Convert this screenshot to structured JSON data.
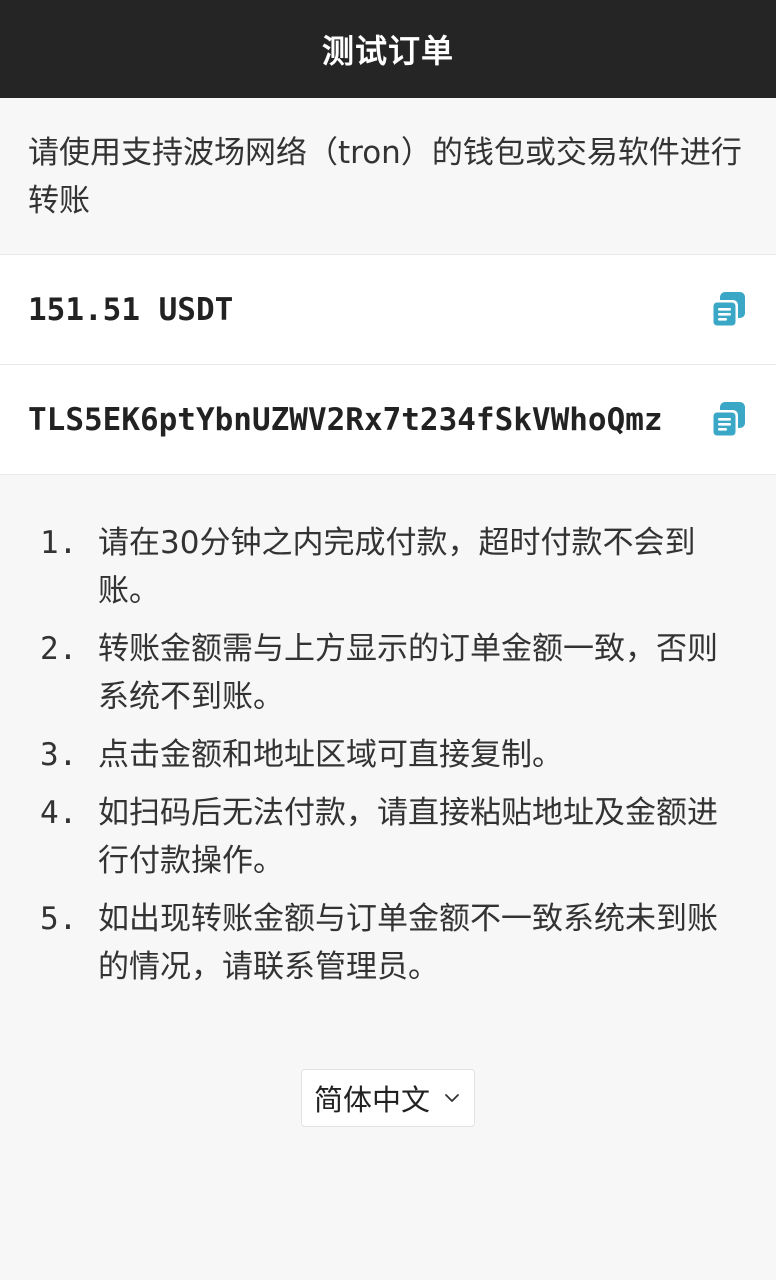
{
  "header": {
    "title": "测试订单"
  },
  "notice": {
    "text": "请使用支持波场网络（tron）的钱包或交易软件进行转账"
  },
  "amount": {
    "value": "151.51 USDT",
    "icon": "copy-icon",
    "icon_color": "#3aa7c6"
  },
  "address": {
    "value": "TLS5EK6ptYbnUZWV2Rx7t234fSkVWhoQmz",
    "icon": "copy-icon",
    "icon_color": "#3aa7c6"
  },
  "instructions": [
    {
      "num": "1.",
      "text": "请在30分钟之内完成付款，超时付款不会到账。"
    },
    {
      "num": "2.",
      "text": "转账金额需与上方显示的订单金额一致，否则系统不到账。"
    },
    {
      "num": "3.",
      "text": "点击金额和地址区域可直接复制。"
    },
    {
      "num": "4.",
      "text": "如扫码后无法付款，请直接粘贴地址及金额进行付款操作。"
    },
    {
      "num": "5.",
      "text": "如出现转账金额与订单金额不一致系统未到账的情况，请联系管理员。"
    }
  ],
  "language": {
    "selected": "简体中文",
    "icon": "chevron-down-icon"
  }
}
